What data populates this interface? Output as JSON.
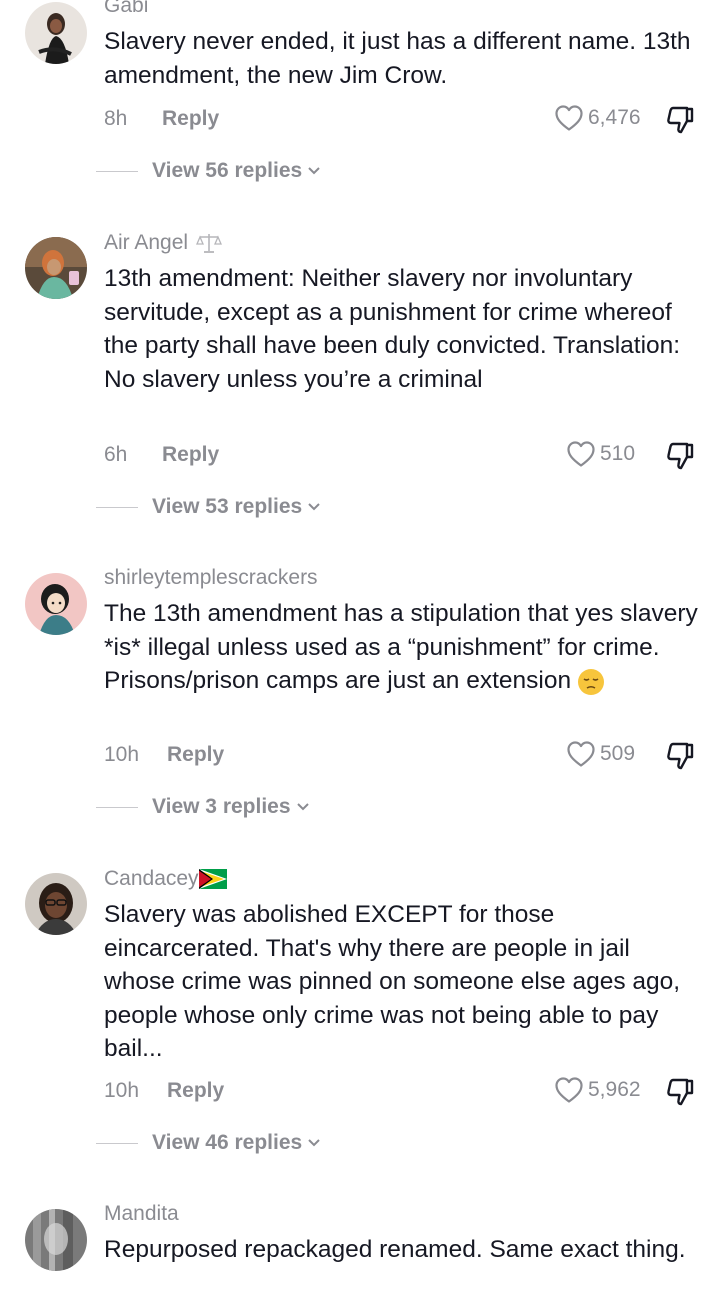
{
  "comments": [
    {
      "username": "Gabi",
      "text": "Slavery never ended, it just has a different name. 13th amendment, the new Jim Crow.",
      "time": "8h",
      "reply_label": "Reply",
      "likes": "6,476",
      "view_replies": "View 56 replies"
    },
    {
      "username": "Air Angel",
      "badge_icon": "balance-scale-icon",
      "text": "13th amendment: Neither slavery nor involuntary servitude, except as a punishment for crime whereof the party shall have been duly convicted. Translation: No slavery unless you’re a criminal",
      "time": "6h",
      "reply_label": "Reply",
      "likes": "510",
      "view_replies": "View 53 replies"
    },
    {
      "username": "shirleytemplescrackers",
      "text": "The 13th amendment has a stipulation that yes slavery *is* illegal unless used as a “punishment” for crime. Prisons/prison camps are just an extension",
      "emoji": "pensive-face-emoji",
      "time": "10h",
      "reply_label": "Reply",
      "likes": "509",
      "view_replies": "View 3 replies"
    },
    {
      "username": "Candacey",
      "badge_icon": "guyana-flag-icon",
      "text": "Slavery was abolished EXCEPT for those eincarcerated. That's why there are people in jail whose crime was pinned on someone else ages ago, people whose only crime was not being able to pay bail...",
      "time": "10h",
      "reply_label": "Reply",
      "likes": "5,962",
      "view_replies": "View 46 replies"
    },
    {
      "username": "Mandita",
      "text": "Repurposed repackaged renamed. Same exact thing."
    }
  ],
  "icons": {
    "like": "heart-outline-icon",
    "dislike": "thumbs-down-icon",
    "expand": "chevron-down-icon"
  },
  "colors": {
    "text": "#161823",
    "muted": "#8a8b91",
    "background": "#ffffff"
  }
}
